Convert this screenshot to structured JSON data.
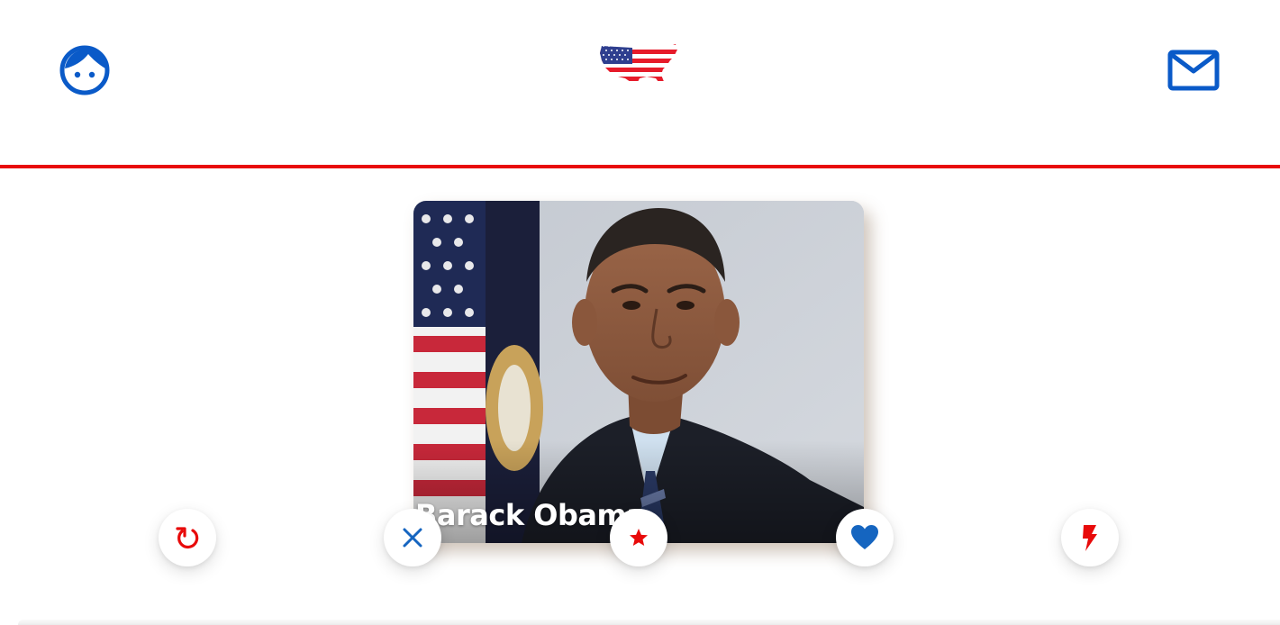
{
  "header": {
    "profile_icon": "face-icon",
    "logo_icon": "usa-flag-map-logo",
    "messages_icon": "envelope-icon"
  },
  "card": {
    "name": "Barack Obama",
    "photo_icon": "portrait-photo"
  },
  "actions": [
    {
      "icon": "undo-icon",
      "color": "#e80a0a"
    },
    {
      "icon": "close-icon",
      "color": "#1565c0"
    },
    {
      "icon": "star-icon",
      "color": "#e80a0a"
    },
    {
      "icon": "heart-icon",
      "color": "#1565c0"
    },
    {
      "icon": "lightning-bolt-icon",
      "color": "#e80a0a"
    }
  ],
  "colors": {
    "accent_blue": "#0a5ac8",
    "accent_red": "#e80a0a",
    "background": "#ffffff"
  }
}
